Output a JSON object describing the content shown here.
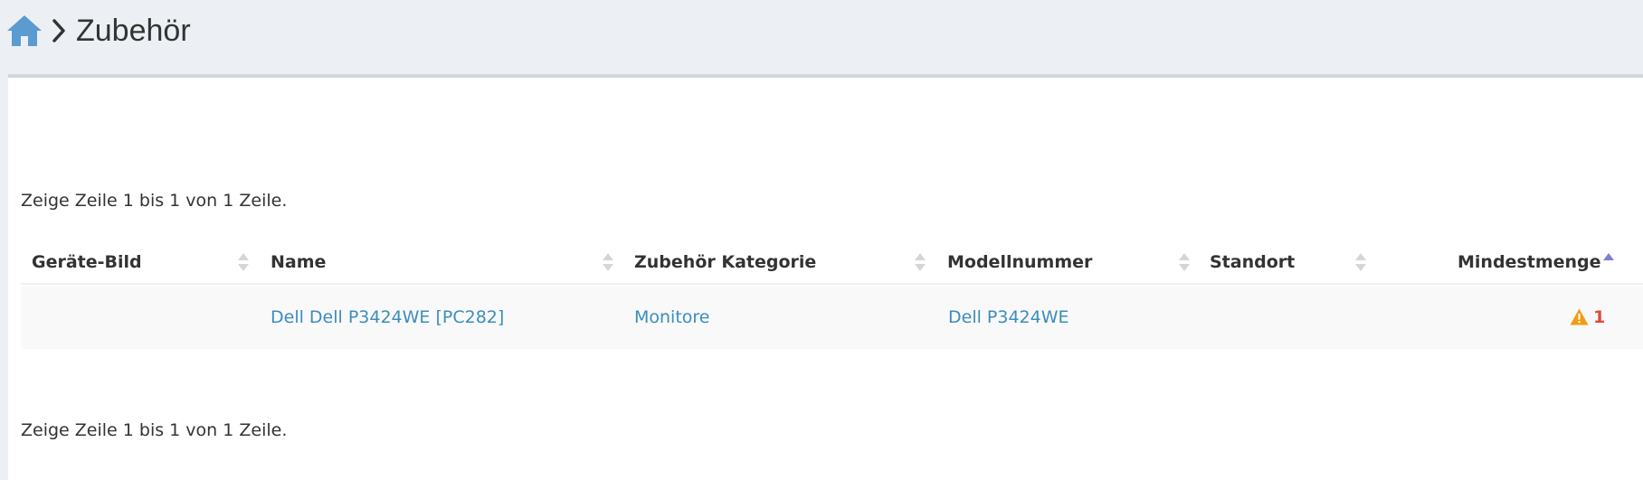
{
  "breadcrumb": {
    "home_icon": "home-icon",
    "separator_icon": "chevron-right-icon",
    "title": "Zubehör"
  },
  "table": {
    "info_top": "Zeige Zeile 1 bis 1 von 1 Zeile.",
    "info_bottom": "Zeige Zeile 1 bis 1 von 1 Zeile.",
    "columns": [
      {
        "label": "Geräte-Bild",
        "sort": "none"
      },
      {
        "label": "Name",
        "sort": "none"
      },
      {
        "label": "Zubehör Kategorie",
        "sort": "none"
      },
      {
        "label": "Modellnummer",
        "sort": "none"
      },
      {
        "label": "Standort",
        "sort": "none"
      },
      {
        "label": "Mindestmenge",
        "sort": "ascending"
      }
    ],
    "rows": [
      {
        "image": "",
        "name": "Dell Dell P3424WE [PC282]",
        "category": "Monitore",
        "model_number": "Dell P3424WE",
        "location": "",
        "min_qty": "1",
        "min_qty_icon": "warning-icon"
      }
    ]
  },
  "colors": {
    "link": "#3c8dbc",
    "warning_icon": "#f39c12",
    "warning_value": "#dd4b39",
    "sort_active": "#7b7fd1",
    "home_icon": "#3c8dbc"
  }
}
